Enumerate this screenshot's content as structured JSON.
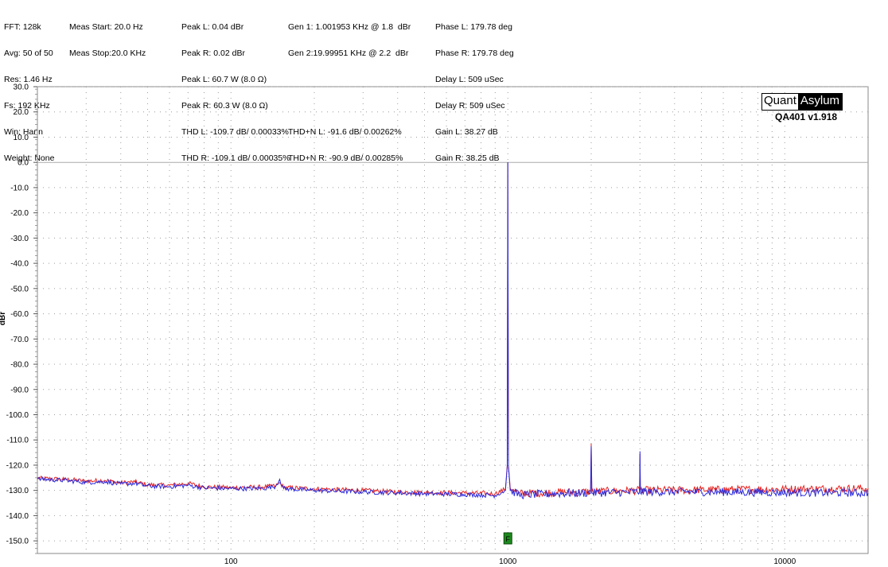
{
  "info": {
    "col1": [
      "FFT: 128k",
      "Avg: 50 of 50",
      "Res: 1.46 Hz",
      "Fs: 192 KHz",
      "Win: Hann",
      "Weight: None"
    ],
    "col2": [
      "Meas Start: 20.0 Hz",
      "Meas Stop:20.0 KHz"
    ],
    "col3": [
      "Peak L: 0.04 dBr",
      "Peak R: 0.02 dBr",
      "Peak L: 60.7 W (8.0 Ω)",
      "Peak R: 60.3 W (8.0 Ω)",
      "THD L: -109.7 dB/ 0.00033%",
      "THD R: -109.1 dB/ 0.00035%"
    ],
    "col4": [
      "Gen 1: 1.001953 KHz @ 1.8  dBr",
      "Gen 2:19.99951 KHz @ 2.2  dBr",
      "",
      "",
      "THD+N L: -91.6 dB/ 0.00262%",
      "THD+N R: -90.9 dB/ 0.00285%"
    ],
    "col5": [
      "Phase L: 179.78 deg",
      "Phase R: 179.78 deg",
      "Delay L: 509 uSec",
      "Delay R: 509 uSec",
      "Gain L: 38.27 dB",
      "Gain R: 38.25 dB"
    ]
  },
  "logo": {
    "part1": "Quant",
    "part2": "Asylum",
    "version": "QA401 v1.918"
  },
  "marker_label": "F",
  "chart_data": {
    "type": "line",
    "xscale": "log",
    "xlim": [
      20,
      20000
    ],
    "ylim": [
      -155,
      30
    ],
    "xticks": [
      100,
      1000,
      10000
    ],
    "xtick_labels": [
      "100",
      "1000",
      "10000"
    ],
    "yticks": [
      30,
      20,
      10,
      0,
      -10,
      -20,
      -30,
      -40,
      -50,
      -60,
      -70,
      -80,
      -90,
      -100,
      -110,
      -120,
      -130,
      -140,
      -150
    ],
    "ytick_labels": [
      "30.0",
      "20.0",
      "10.0",
      "0.0",
      "-10.0",
      "-20.0",
      "-30.0",
      "-40.0",
      "-50.0",
      "-60.0",
      "-70.0",
      "-80.0",
      "-90.0",
      "-100.0",
      "-110.0",
      "-120.0",
      "-130.0",
      "-140.0",
      "-150.0"
    ],
    "ylabel": "dBr",
    "grid": true,
    "series": [
      {
        "color": "#e8221e",
        "points": [
          [
            20,
            -125.2
          ],
          [
            25,
            -125.6
          ],
          [
            30,
            -126.3
          ],
          [
            35,
            -126.0
          ],
          [
            40,
            -127.0
          ],
          [
            45,
            -126.6
          ],
          [
            50,
            -127.8
          ],
          [
            60,
            -128.0
          ],
          [
            70,
            -127.2
          ],
          [
            80,
            -128.6
          ],
          [
            100,
            -128.9
          ],
          [
            130,
            -128.7
          ],
          [
            145,
            -128.2
          ],
          [
            150,
            -127.0
          ],
          [
            155,
            -128.8
          ],
          [
            200,
            -129.4
          ],
          [
            300,
            -130.0
          ],
          [
            400,
            -130.6
          ],
          [
            500,
            -130.8
          ],
          [
            700,
            -131.0
          ],
          [
            900,
            -131.3
          ],
          [
            980,
            -129.5
          ],
          [
            995,
            -120.0
          ],
          [
            1000,
            0.04
          ],
          [
            1005,
            -120.0
          ],
          [
            1020,
            -129.0
          ],
          [
            1100,
            -131.2
          ],
          [
            1500,
            -130.8
          ],
          [
            1990,
            -130.5
          ],
          [
            2000,
            -111.5
          ],
          [
            2010,
            -130.5
          ],
          [
            2500,
            -130.2
          ],
          [
            2990,
            -130.0
          ],
          [
            3000,
            -115.5
          ],
          [
            3010,
            -130.0
          ],
          [
            5000,
            -129.8
          ],
          [
            8000,
            -129.6
          ],
          [
            12000,
            -129.4
          ],
          [
            20000,
            -129.2
          ]
        ]
      },
      {
        "color": "#2a2adc",
        "points": [
          [
            20,
            -125.5
          ],
          [
            25,
            -126.0
          ],
          [
            30,
            -126.8
          ],
          [
            35,
            -126.5
          ],
          [
            40,
            -127.5
          ],
          [
            45,
            -127.2
          ],
          [
            50,
            -128.3
          ],
          [
            60,
            -128.5
          ],
          [
            70,
            -128.0
          ],
          [
            80,
            -129.0
          ],
          [
            100,
            -129.3
          ],
          [
            130,
            -129.2
          ],
          [
            145,
            -128.4
          ],
          [
            150,
            -125.6
          ],
          [
            155,
            -129.3
          ],
          [
            200,
            -130.0
          ],
          [
            300,
            -130.6
          ],
          [
            400,
            -131.0
          ],
          [
            500,
            -131.3
          ],
          [
            700,
            -131.6
          ],
          [
            900,
            -132.0
          ],
          [
            980,
            -130.0
          ],
          [
            995,
            -120.5
          ],
          [
            1000,
            0.02
          ],
          [
            1005,
            -120.5
          ],
          [
            1020,
            -130.0
          ],
          [
            1100,
            -131.8
          ],
          [
            1500,
            -131.3
          ],
          [
            1990,
            -131.0
          ],
          [
            2000,
            -112.5
          ],
          [
            2010,
            -131.0
          ],
          [
            2500,
            -130.8
          ],
          [
            2990,
            -130.6
          ],
          [
            3000,
            -114.5
          ],
          [
            3010,
            -130.6
          ],
          [
            5000,
            -130.6
          ],
          [
            8000,
            -130.8
          ],
          [
            12000,
            -130.9
          ],
          [
            20000,
            -131.0
          ]
        ]
      }
    ]
  }
}
